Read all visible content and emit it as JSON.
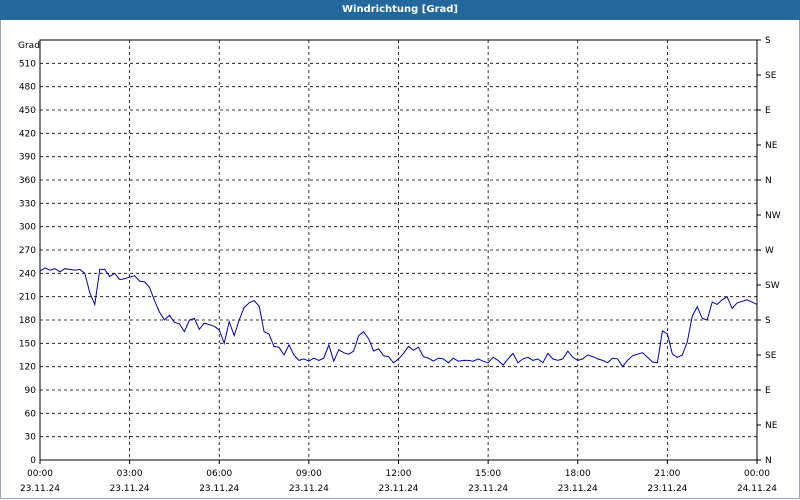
{
  "chart_data": {
    "type": "line",
    "title": "Windrichtung [Grad]",
    "ylabel": "Grad",
    "ylim": [
      0,
      540
    ],
    "yticks": [
      0,
      30,
      60,
      90,
      120,
      150,
      180,
      210,
      240,
      270,
      300,
      330,
      360,
      390,
      420,
      450,
      480,
      510
    ],
    "right_axis_labels": [
      "N",
      "NE",
      "E",
      "SE",
      "S",
      "SW",
      "W",
      "NW",
      "N",
      "NE",
      "E",
      "SE",
      "S"
    ],
    "x_tick_labels": [
      {
        "time": "00:00",
        "date": "23.11.24"
      },
      {
        "time": "03:00",
        "date": "23.11.24"
      },
      {
        "time": "06:00",
        "date": "23.11.24"
      },
      {
        "time": "09:00",
        "date": "23.11.24"
      },
      {
        "time": "12:00",
        "date": "23.11.24"
      },
      {
        "time": "15:00",
        "date": "23.11.24"
      },
      {
        "time": "18:00",
        "date": "23.11.24"
      },
      {
        "time": "21:00",
        "date": "23.11.24"
      },
      {
        "time": "00:00",
        "date": "24.11.24"
      }
    ],
    "xlim": [
      "23.11.24 00:00",
      "24.11.24 00:00"
    ],
    "grid": true,
    "line_color": "#0000aa",
    "series": [
      {
        "x": [
          "00:00",
          "00:10",
          "00:20",
          "00:30",
          "00:40",
          "00:50",
          "01:00",
          "01:10",
          "01:20",
          "01:30",
          "01:40",
          "01:50",
          "02:00",
          "02:10",
          "02:20",
          "02:30",
          "02:40",
          "02:50",
          "03:00",
          "03:10",
          "03:20",
          "03:30",
          "03:40",
          "03:50",
          "04:00",
          "04:10",
          "04:20",
          "04:30",
          "04:40",
          "04:50",
          "05:00",
          "05:10",
          "05:20",
          "05:30",
          "05:40",
          "05:50",
          "06:00",
          "06:10",
          "06:20",
          "06:30",
          "06:40",
          "06:50",
          "07:00",
          "07:10",
          "07:20",
          "07:30",
          "07:40",
          "07:50",
          "08:00",
          "08:10",
          "08:20",
          "08:30",
          "08:40",
          "08:50",
          "09:00",
          "09:10",
          "09:20",
          "09:30",
          "09:40",
          "09:50",
          "10:00",
          "10:10",
          "10:20",
          "10:30",
          "10:40",
          "10:50",
          "11:00",
          "11:10",
          "11:20",
          "11:30",
          "11:40",
          "11:50",
          "12:00",
          "12:10",
          "12:20",
          "12:30",
          "12:40",
          "12:50",
          "13:00",
          "13:10",
          "13:20",
          "13:30",
          "13:40",
          "13:50",
          "14:00",
          "14:10",
          "14:20",
          "14:30",
          "14:40",
          "14:50",
          "15:00",
          "15:10",
          "15:20",
          "15:30",
          "15:40",
          "15:50",
          "16:00",
          "16:10",
          "16:20",
          "16:30",
          "16:40",
          "16:50",
          "17:00",
          "17:10",
          "17:20",
          "17:30",
          "17:40",
          "17:50",
          "18:00",
          "18:10",
          "18:20",
          "18:30",
          "18:40",
          "18:50",
          "19:00",
          "19:10",
          "19:20",
          "19:30",
          "19:40",
          "19:50",
          "20:00",
          "20:10",
          "20:20",
          "20:30",
          "20:40",
          "20:50",
          "21:00",
          "21:10",
          "21:20",
          "21:30",
          "21:40",
          "21:50",
          "22:00",
          "22:10",
          "22:20",
          "22:30",
          "22:40",
          "22:50",
          "23:00",
          "23:10",
          "23:20",
          "23:30",
          "23:40",
          "23:50",
          "00:00"
        ],
        "values": [
          243,
          247,
          244,
          246,
          242,
          246,
          245,
          244,
          245,
          240,
          215,
          200,
          245,
          245,
          236,
          240,
          232,
          233,
          235,
          237,
          230,
          229,
          222,
          205,
          190,
          180,
          186,
          177,
          175,
          165,
          180,
          182,
          168,
          176,
          174,
          172,
          167,
          150,
          178,
          160,
          180,
          196,
          202,
          205,
          198,
          165,
          162,
          146,
          145,
          135,
          148,
          135,
          128,
          130,
          127,
          131,
          128,
          131,
          148,
          127,
          142,
          138,
          136,
          140,
          160,
          165,
          156,
          140,
          143,
          134,
          133,
          125,
          130,
          137,
          146,
          141,
          145,
          133,
          131,
          127,
          131,
          130,
          125,
          131,
          127,
          128,
          128,
          127,
          130,
          127,
          125,
          132,
          128,
          122,
          130,
          137,
          125,
          130,
          132,
          128,
          130,
          125,
          137,
          130,
          128,
          130,
          140,
          132,
          128,
          130,
          135,
          133,
          130,
          128,
          125,
          131,
          130,
          120,
          128,
          134,
          136,
          138,
          132,
          126,
          125,
          166,
          162,
          136,
          132,
          135,
          152,
          185,
          197,
          182,
          180,
          203,
          200,
          206,
          210,
          195,
          202,
          204,
          206,
          203,
          200
        ]
      }
    ]
  }
}
